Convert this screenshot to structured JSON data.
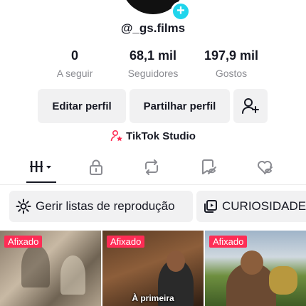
{
  "profile": {
    "username": "@_gs.films"
  },
  "stats": [
    {
      "value": "0",
      "label": "A seguir"
    },
    {
      "value": "68,1 mil",
      "label": "Seguidores"
    },
    {
      "value": "197,9 mil",
      "label": "Gostos"
    }
  ],
  "actions": {
    "edit_label": "Editar perfil",
    "share_label": "Partilhar perfil"
  },
  "studio": {
    "label": "TikTok Studio"
  },
  "tabs": [
    "videos-grid",
    "private",
    "reposts",
    "favorites",
    "liked"
  ],
  "chips": {
    "playlists_label": "Gerir listas de reprodução",
    "curiosidades_label": "CURIOSIDADES"
  },
  "videos": [
    {
      "pin_label": "Afixado",
      "caption": ""
    },
    {
      "pin_label": "Afixado",
      "caption": "À primeira"
    },
    {
      "pin_label": "Afixado",
      "caption": ""
    }
  ],
  "colors": {
    "accent": "#fe2c55",
    "add_badge": "#20d5ec"
  }
}
